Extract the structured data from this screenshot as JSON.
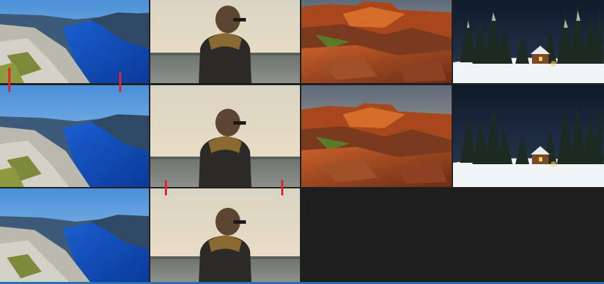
{
  "gallery": {
    "rows": [
      {
        "tiles": [
          {
            "name": "fjord-photo",
            "icon": "fjord-landscape-image"
          },
          {
            "name": "person-scarf-photo",
            "icon": "person-at-lake-image"
          },
          {
            "name": "red-cliffs-photo",
            "icon": "red-cliffs-image"
          },
          {
            "name": "snow-cabin-photo",
            "icon": "snow-cabin-image"
          }
        ]
      },
      {
        "tiles": [
          {
            "name": "fjord-photo",
            "icon": "fjord-landscape-image"
          },
          {
            "name": "person-scarf-photo",
            "icon": "person-at-lake-image"
          },
          {
            "name": "red-cliffs-photo",
            "icon": "red-cliffs-image"
          },
          {
            "name": "snow-cabin-photo",
            "icon": "snow-cabin-image"
          }
        ]
      },
      {
        "tiles": [
          {
            "name": "fjord-photo",
            "icon": "fjord-landscape-image"
          },
          {
            "name": "person-scarf-photo",
            "icon": "person-at-lake-image"
          }
        ]
      }
    ],
    "colors": {
      "background": "#1f1f20",
      "marker": "#e0232f",
      "accent_line": "#2b6fb0"
    }
  }
}
